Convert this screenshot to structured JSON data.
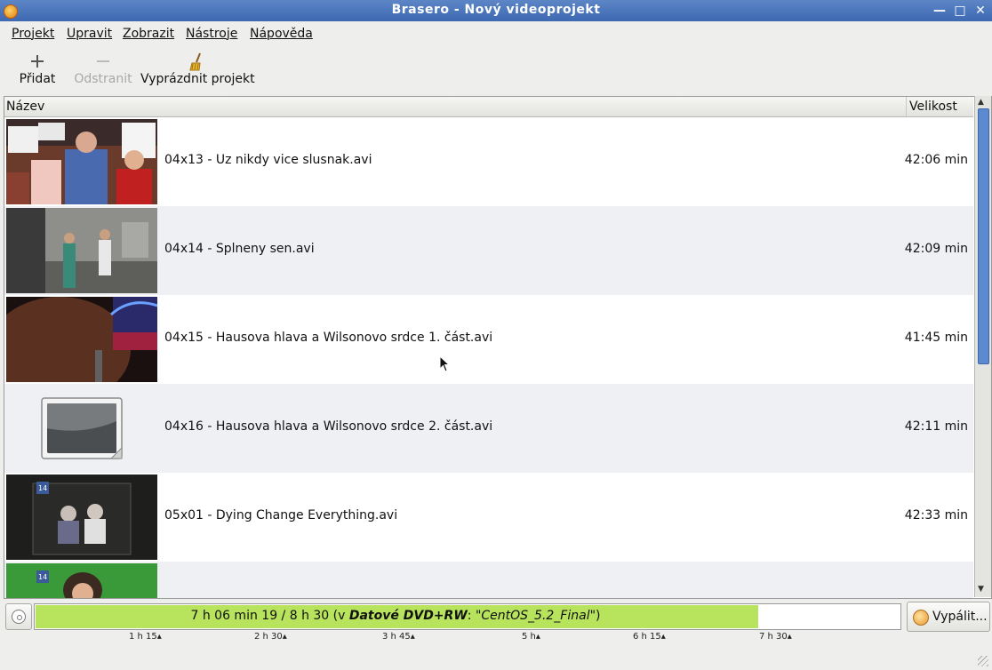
{
  "window": {
    "title": "Brasero - Nový videoprojekt",
    "controls": [
      "minimize-icon",
      "maximize-icon",
      "close-icon"
    ]
  },
  "menubar": {
    "items": [
      {
        "label": "Projekt"
      },
      {
        "label": "Upravit"
      },
      {
        "label": "Zobrazit"
      },
      {
        "label": "Nástroje"
      },
      {
        "label": "Nápověda"
      }
    ]
  },
  "toolbar": {
    "add_label": "Přidat",
    "remove_label": "Odstranit",
    "clear_label": "Vyprázdnit projekt"
  },
  "list": {
    "columns": {
      "name": "Název",
      "size": "Velikost"
    },
    "rows": [
      {
        "name": "04x13 - Uz nikdy vice slusnak.avi",
        "size": "42:06 min"
      },
      {
        "name": "04x14 - Splneny sen.avi",
        "size": "42:09 min"
      },
      {
        "name": "04x15 - Hausova hlava a Wilsonovo srdce 1. část.avi",
        "size": "41:45 min"
      },
      {
        "name": "04x16 - Hausova hlava a Wilsonovo srdce 2. část.avi",
        "size": "42:11 min"
      },
      {
        "name": "05x01 - Dying Change Everything.avi",
        "size": "42:33 min"
      },
      {
        "name": "",
        "size": ""
      }
    ]
  },
  "status": {
    "used": "7 h 06 min 19 / 8 h 30 (v ",
    "media_type": "Datové DVD+RW",
    "sep": ": ",
    "volume": "\"CentOS_5.2_Final\"",
    "close_paren": ")",
    "fill_fraction": 0.836,
    "fill_color": "#b8e35c",
    "burn_label": "Vypálit...",
    "ticks": [
      "1 h 15",
      "2 h 30",
      "3 h 45",
      "5 h",
      "6 h 15",
      "7 h 30"
    ]
  },
  "colors": {
    "titlebar": "#3d69b2",
    "row_alt": "#eef0f3",
    "scrollbar_thumb": "#5b8ad0"
  }
}
